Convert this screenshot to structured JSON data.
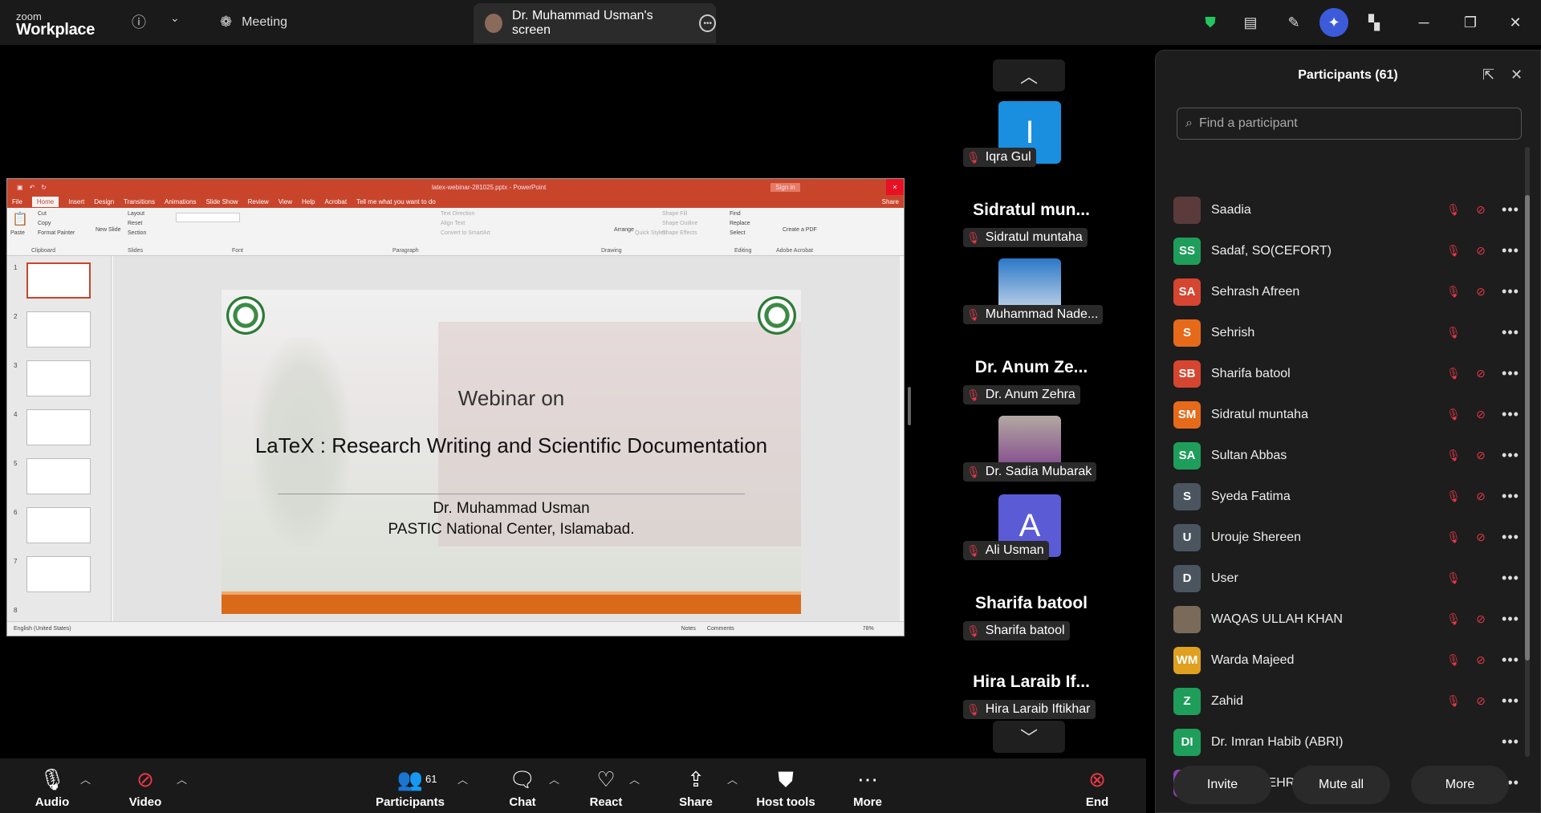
{
  "app": {
    "logo_top": "zoom",
    "logo_bottom": "Workplace"
  },
  "titlebar": {
    "meeting_tab": "Meeting",
    "screen_tab": "Dr. Muhammad Usman's screen"
  },
  "ppt": {
    "window_title": "latex-webinar-281025.pptx - PowerPoint",
    "signin": "Sign in",
    "menu": [
      "File",
      "Home",
      "Insert",
      "Design",
      "Transitions",
      "Animations",
      "Slide Show",
      "Review",
      "View",
      "Help",
      "Acrobat"
    ],
    "tell_me": "Tell me what you want to do",
    "share": "Share",
    "ribbon_groups": [
      "Clipboard",
      "Slides",
      "Font",
      "Paragraph",
      "Drawing",
      "Editing",
      "Adobe Acrobat"
    ],
    "ribbon_items": {
      "paste": "Paste",
      "cut": "Cut",
      "copy": "Copy",
      "format_painter": "Format Painter",
      "new_slide": "New Slide",
      "layout": "Layout",
      "reset": "Reset",
      "section": "Section",
      "text_direction": "Text Direction",
      "align_text": "Align Text",
      "convert_smartart": "Convert to SmartArt",
      "arrange": "Arrange",
      "quick_styles": "Quick Styles",
      "shape_fill": "Shape Fill",
      "shape_outline": "Shape Outline",
      "shape_effects": "Shape Effects",
      "find": "Find",
      "replace": "Replace",
      "select": "Select",
      "create_pdf": "Create a PDF"
    },
    "thumb_numbers": [
      "1",
      "2",
      "3",
      "4",
      "5",
      "6",
      "7",
      "8"
    ],
    "status_lang": "English (United States)",
    "status_notes": "Notes",
    "status_comments": "Comments",
    "zoom": "78%"
  },
  "slide": {
    "line1": "Webinar on",
    "line2": "LaTeX : Research Writing and Scientific Documentation",
    "line3": "Dr. Muhammad Usman",
    "line4": "PASTIC National Center, Islamabad."
  },
  "tiles": [
    {
      "big": "",
      "label": "Iqra Gul",
      "initial": "I",
      "color": "#1a8fe0"
    },
    {
      "big": "Sidratul mun...",
      "label": "Sidratul muntaha"
    },
    {
      "big": "",
      "label": "Muhammad Nade..."
    },
    {
      "big": "Dr. Anum Ze...",
      "label": "Dr. Anum Zehra"
    },
    {
      "big": "",
      "label": "Dr. Sadia Mubarak"
    },
    {
      "big": "",
      "label": "Ali Usman",
      "initial": "A",
      "color": "#5b5bd6"
    },
    {
      "big": "Sharifa batool",
      "label": "Sharifa batool"
    },
    {
      "big": "Hira Laraib If...",
      "label": "Hira Laraib Iftikhar"
    }
  ],
  "panel": {
    "title": "Participants (61)",
    "search_placeholder": "Find a participant",
    "participants": [
      {
        "initials": "",
        "name": "Saadia",
        "color": "#5a3a3a",
        "muted": true,
        "video_off": true
      },
      {
        "initials": "SS",
        "name": "Sadaf, SO(CEFORT)",
        "color": "#1e9e5a",
        "muted": true,
        "video_off": true
      },
      {
        "initials": "SA",
        "name": "Sehrash Afreen",
        "color": "#d6452f",
        "muted": true,
        "video_off": true
      },
      {
        "initials": "S",
        "name": "Sehrish",
        "color": "#e66a1a",
        "muted": true,
        "video_off": false
      },
      {
        "initials": "SB",
        "name": "Sharifa batool",
        "color": "#d6452f",
        "muted": true,
        "video_off": true
      },
      {
        "initials": "SM",
        "name": "Sidratul muntaha",
        "color": "#e66a1a",
        "muted": true,
        "video_off": true
      },
      {
        "initials": "SA",
        "name": "Sultan Abbas",
        "color": "#1e9e5a",
        "muted": true,
        "video_off": true
      },
      {
        "initials": "S",
        "name": "Syeda Fatima",
        "color": "#4a5560",
        "muted": true,
        "video_off": true
      },
      {
        "initials": "U",
        "name": "Urouje Shereen",
        "color": "#4a5560",
        "muted": true,
        "video_off": true
      },
      {
        "initials": "D",
        "name": "User",
        "color": "#4a5560",
        "muted": true,
        "video_off": false
      },
      {
        "initials": "",
        "name": "WAQAS ULLAH KHAN",
        "color": "#7a6a5a",
        "muted": true,
        "video_off": true
      },
      {
        "initials": "WM",
        "name": "Warda Majeed",
        "color": "#e0a020",
        "muted": true,
        "video_off": true
      },
      {
        "initials": "Z",
        "name": "Zahid",
        "color": "#1e9e5a",
        "muted": true,
        "video_off": true
      },
      {
        "initials": "DI",
        "name": "Dr. Imran Habib (ABRI)",
        "color": "#1e9e5a",
        "muted": false,
        "video_off": false
      },
      {
        "initials": "GE",
        "name": "GULL E ZEHRA",
        "color": "#8e44ad",
        "muted": false,
        "video_off": false
      }
    ],
    "invite": "Invite",
    "mute_all": "Mute all",
    "more": "More"
  },
  "toolbar": {
    "audio": "Audio",
    "video": "Video",
    "participants": "Participants",
    "participants_count": "61",
    "chat": "Chat",
    "react": "React",
    "share": "Share",
    "host_tools": "Host tools",
    "more": "More",
    "end": "End"
  }
}
